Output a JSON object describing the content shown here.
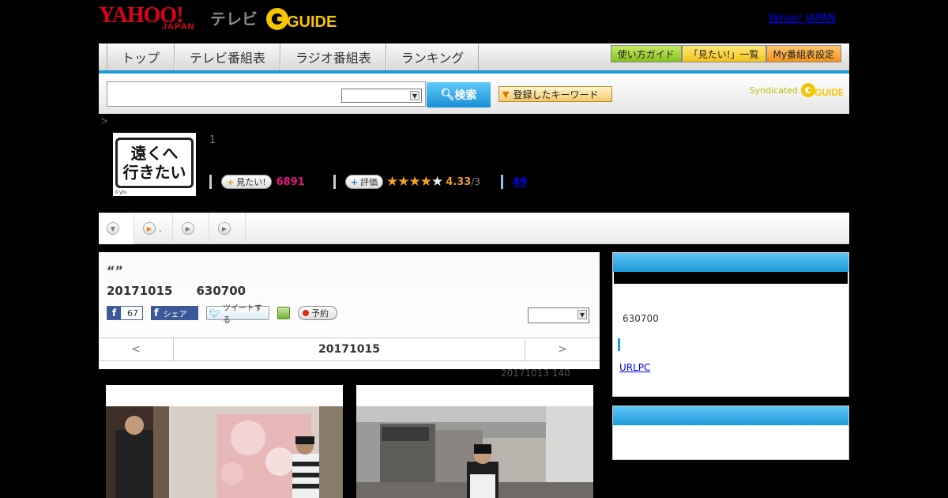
{
  "header": {
    "logo_yahoo": "YAHOO!",
    "logo_japan": "JAPAN",
    "logo_tv": "テレビ",
    "logo_gguide": "GUIDE",
    "link_yahoo": "Yahoo! JAPAN"
  },
  "nav": {
    "tabs": [
      "トップ",
      "テレビ番組表",
      "ラジオ番組表",
      "ランキング"
    ],
    "buttons": [
      "使い方ガイド",
      "「見たい!」一覧",
      "My番組表設定"
    ]
  },
  "search": {
    "button_label": "検索",
    "keyword_button": "登録したキーワード",
    "syndicated": "Syndicated",
    "syndicated_logo": "GUIDE"
  },
  "breadcrumb": ">",
  "program": {
    "thumb_title_line1": "遠くへ",
    "thumb_title_line2": "行きたい",
    "thumb_copyright": "©ytv",
    "episode_number": "1",
    "want_label": "見たい!",
    "want_count": "6891",
    "rate_label": "評価",
    "stars_on": "★★★★",
    "stars_off": "★",
    "rating": "4.33",
    "rating_den": "/3",
    "review_count": "49"
  },
  "program_tabs": [
    {
      "label": ""
    },
    {
      "label": "."
    },
    {
      "label": ""
    },
    {
      "label": ""
    }
  ],
  "panel": {
    "quote": "“”",
    "date": "20171015",
    "time": "630700",
    "fb_like_count": "67",
    "fb_share": "シェア",
    "tweet": "ツイートする",
    "reserve": "予約",
    "nav_prev": "<",
    "nav_date": "20171015",
    "nav_next": ">",
    "update_note": "20171013 140"
  },
  "sidebar": {
    "time": "630700",
    "link": "URLPC"
  }
}
